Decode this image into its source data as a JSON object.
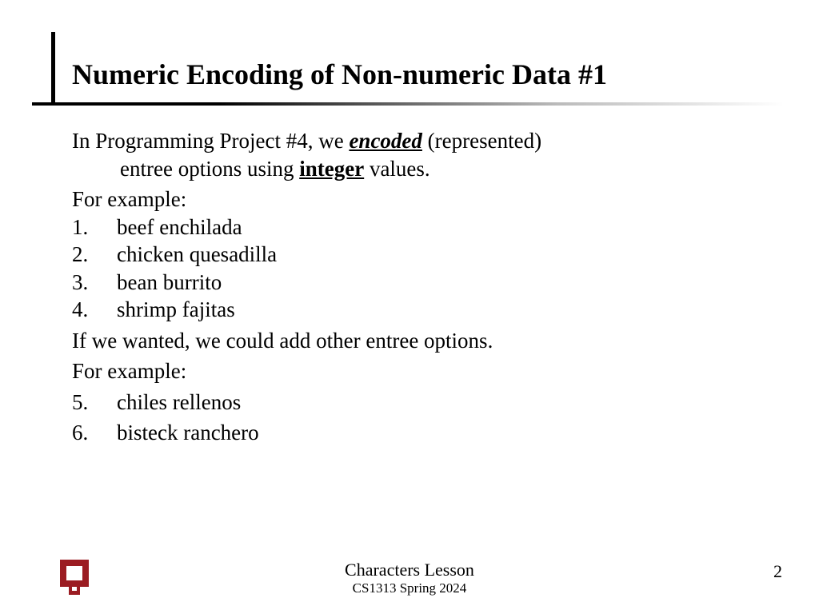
{
  "title": "Numeric Encoding of Non-numeric Data #1",
  "body": {
    "intro_a": "In Programming Project #4, we ",
    "intro_emph": "encoded",
    "intro_b": " (represented)",
    "intro_line2_a": "entree options using ",
    "intro_integer": "integer",
    "intro_line2_b": " values.",
    "forexample1": "For example:",
    "items1": [
      {
        "n": "1.",
        "t": "beef enchilada"
      },
      {
        "n": "2.",
        "t": "chicken quesadilla"
      },
      {
        "n": "3.",
        "t": "bean burrito"
      },
      {
        "n": "4.",
        "t": "shrimp fajitas"
      }
    ],
    "addmore": "If we wanted, we could add other entree options.",
    "forexample2": "For example:",
    "items2": [
      {
        "n": "5.",
        "t": "chiles rellenos"
      },
      {
        "n": "6.",
        "t": "bisteck ranchero"
      }
    ]
  },
  "footer": {
    "lesson": "Characters Lesson",
    "course": "CS1313 Spring 2024",
    "page": "2",
    "logo_name": "ou-logo"
  }
}
